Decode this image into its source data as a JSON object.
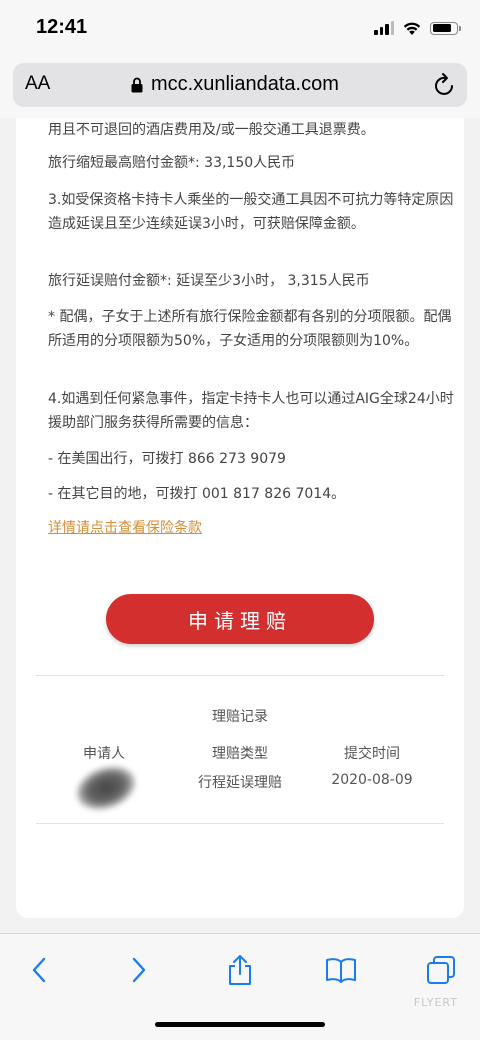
{
  "status_bar": {
    "time": "12:41"
  },
  "address_bar": {
    "text_size_label": "AA",
    "url": "mcc.xunliandata.com"
  },
  "content": {
    "paragraphs": [
      "用且不可退回的酒店费用及/或一般交通工具退票费。",
      "旅行缩短最高赔付金额*:  33,150人民币",
      "3.如受保资格卡持卡人乘坐的一般交通工具因不可抗力等特定原因造成延误且至少连续延误3小时，可获赔保障金额。",
      "旅行延误赔付金额*: 延误至少3小时，  3,315人民币",
      "* 配偶，子女于上述所有旅行保险金额都有各别的分项限额。配偶所适用的分项限额为50%，子女适用的分项限额则为10%。",
      "4.如遇到任何紧急事件，指定卡持卡人也可以通过AIG全球24小时援助部门服务获得所需要的信息：",
      "- 在美国出行，可拨打 866 273 9079",
      "- 在其它目的地，可拨打 001 817 826 7014。"
    ],
    "terms_link": "详情请点击查看保险条款",
    "claim_button": "申请理赔"
  },
  "records": {
    "title": "理赔记录",
    "headers": [
      "申请人",
      "理赔类型",
      "提交时间"
    ],
    "rows": [
      {
        "applicant": "",
        "type": "行程延误理赔",
        "date": "2020-08-09"
      }
    ]
  },
  "watermark": "FLYERT",
  "colors": {
    "accent": "#d32f2f",
    "link": "#d98d36",
    "toolbar_icon": "#1a7cf5"
  }
}
